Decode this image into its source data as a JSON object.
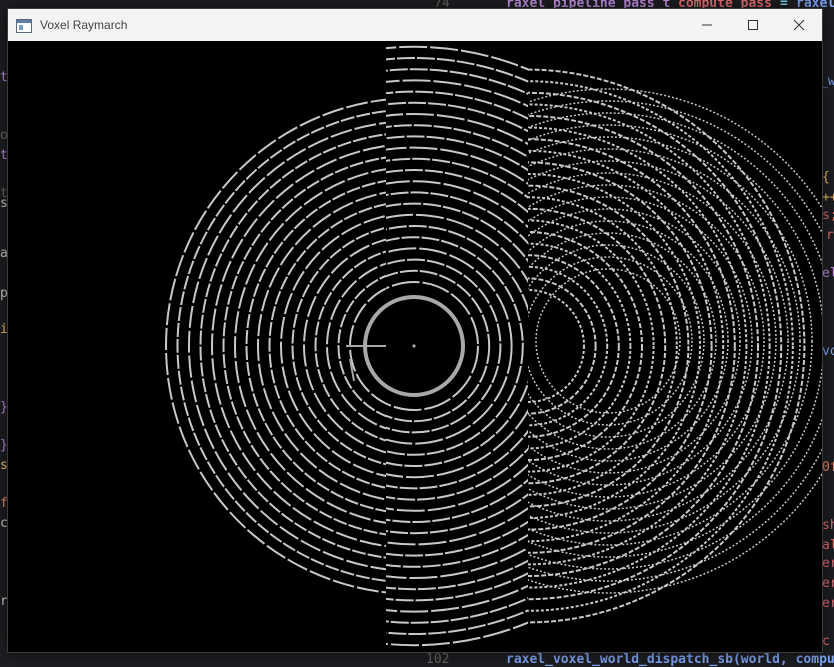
{
  "editor": {
    "top_line": {
      "line_number": "74",
      "type": "raxel_pipeline_pass_t",
      "var": "compute_pass",
      "op": "=",
      "rhs": "raxel"
    },
    "bottom_line": {
      "line_number": "102",
      "call": "raxel_voxel_world_dispatch_sb(world, compu"
    },
    "left_fragments": [
      "t",
      "t",
      "o",
      "t",
      "s",
      "a",
      "p",
      "i",
      "}",
      "}",
      "s",
      "f",
      "c",
      "r"
    ],
    "right_fragments": [
      "_w",
      "{",
      "++",
      "s;",
      "r",
      "el",
      "vo",
      "0f",
      "sh",
      "al",
      "er",
      "er",
      "er",
      "c"
    ]
  },
  "window": {
    "title": "Voxel Raymarch",
    "icon": "app-window-icon",
    "controls": {
      "minimize_icon": "minimize-icon",
      "maximize_icon": "maximize-icon",
      "close_icon": "close-icon"
    }
  },
  "viewport": {
    "background": "#000000",
    "stroke_color": "#c8c8c8",
    "center_point_color": "#aaaaaa"
  }
}
